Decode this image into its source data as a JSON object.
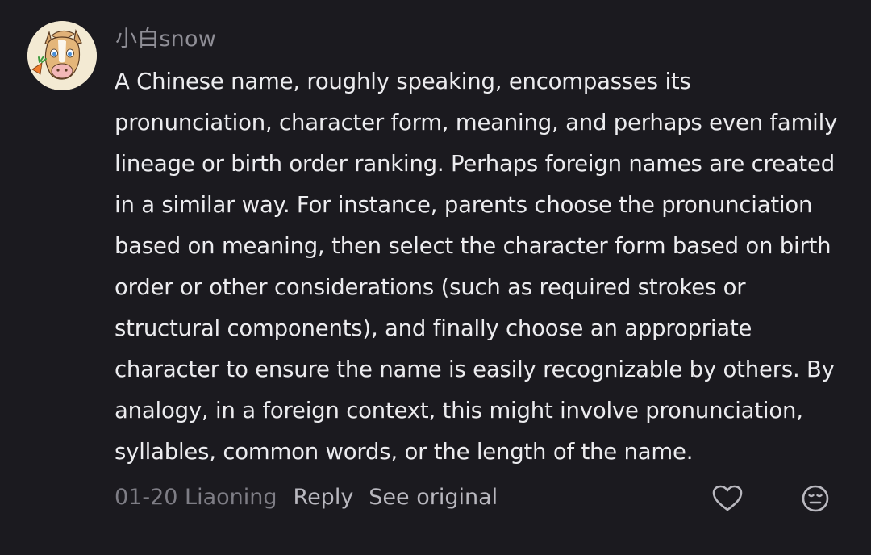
{
  "comment": {
    "username": "小白snow",
    "text": "A Chinese name, roughly speaking, encompasses its pronunciation, character form, meaning, and perhaps even family lineage or birth order ranking. Perhaps foreign names are created in a similar way. For instance, parents choose the pronunciation based on meaning, then select the character form based on birth order or other considerations (such as required strokes or structural components), and finally choose an appropriate character to ensure the name is easily recognizable by others. By analogy, in a foreign context, this might involve pronunciation, syllables, common words, or the length of the name.",
    "date_location": "01-20 Liaoning",
    "reply_label": "Reply",
    "see_original_label": "See original"
  },
  "icons": {
    "avatar": "cartoon-horse-avatar",
    "like": "heart-outline-icon",
    "dislike": "meh-face-icon"
  },
  "colors": {
    "background": "#1b1a1f",
    "text": "#ececef",
    "muted": "#8f8e96",
    "action": "#b9b8bf"
  }
}
